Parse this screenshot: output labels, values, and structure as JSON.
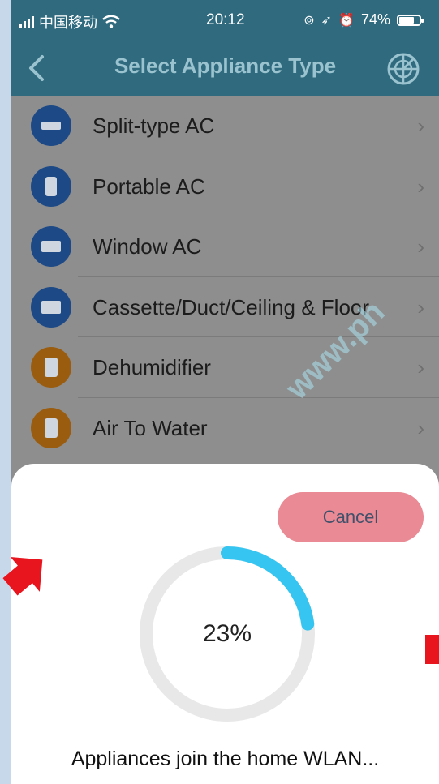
{
  "status_bar": {
    "carrier": "中国移动",
    "time": "20:12",
    "battery_percent": "74%",
    "battery_level": 0.74
  },
  "header": {
    "title": "Select Appliance Type",
    "back_icon": "chevron-left-icon",
    "scan_icon": "radar-scan-icon"
  },
  "appliances": [
    {
      "label": "Split-type AC",
      "icon": "split-ac-icon",
      "color": "#1d4a86"
    },
    {
      "label": "Portable AC",
      "icon": "portable-ac-icon",
      "color": "#1d4a86"
    },
    {
      "label": "Window AC",
      "icon": "window-ac-icon",
      "color": "#1d4a86"
    },
    {
      "label": "Cassette/Duct/Ceiling & Floor",
      "icon": "cassette-ac-icon",
      "color": "#1d4a86"
    },
    {
      "label": "Dehumidifier",
      "icon": "dehumidifier-icon",
      "color": "#9a5d10"
    },
    {
      "label": "Air To Water",
      "icon": "air-to-water-icon",
      "color": "#9a5d10"
    }
  ],
  "chevron": "›",
  "sheet": {
    "cancel_label": "Cancel",
    "progress_text": "23%",
    "progress_value": 0.23,
    "message": "Appliances join the home WLAN..."
  },
  "watermark": "www.ph",
  "colors": {
    "header": "#2f6a7e",
    "progress": "#35c5f0",
    "cancel": "#e98a94",
    "marker": "#e8141e"
  }
}
